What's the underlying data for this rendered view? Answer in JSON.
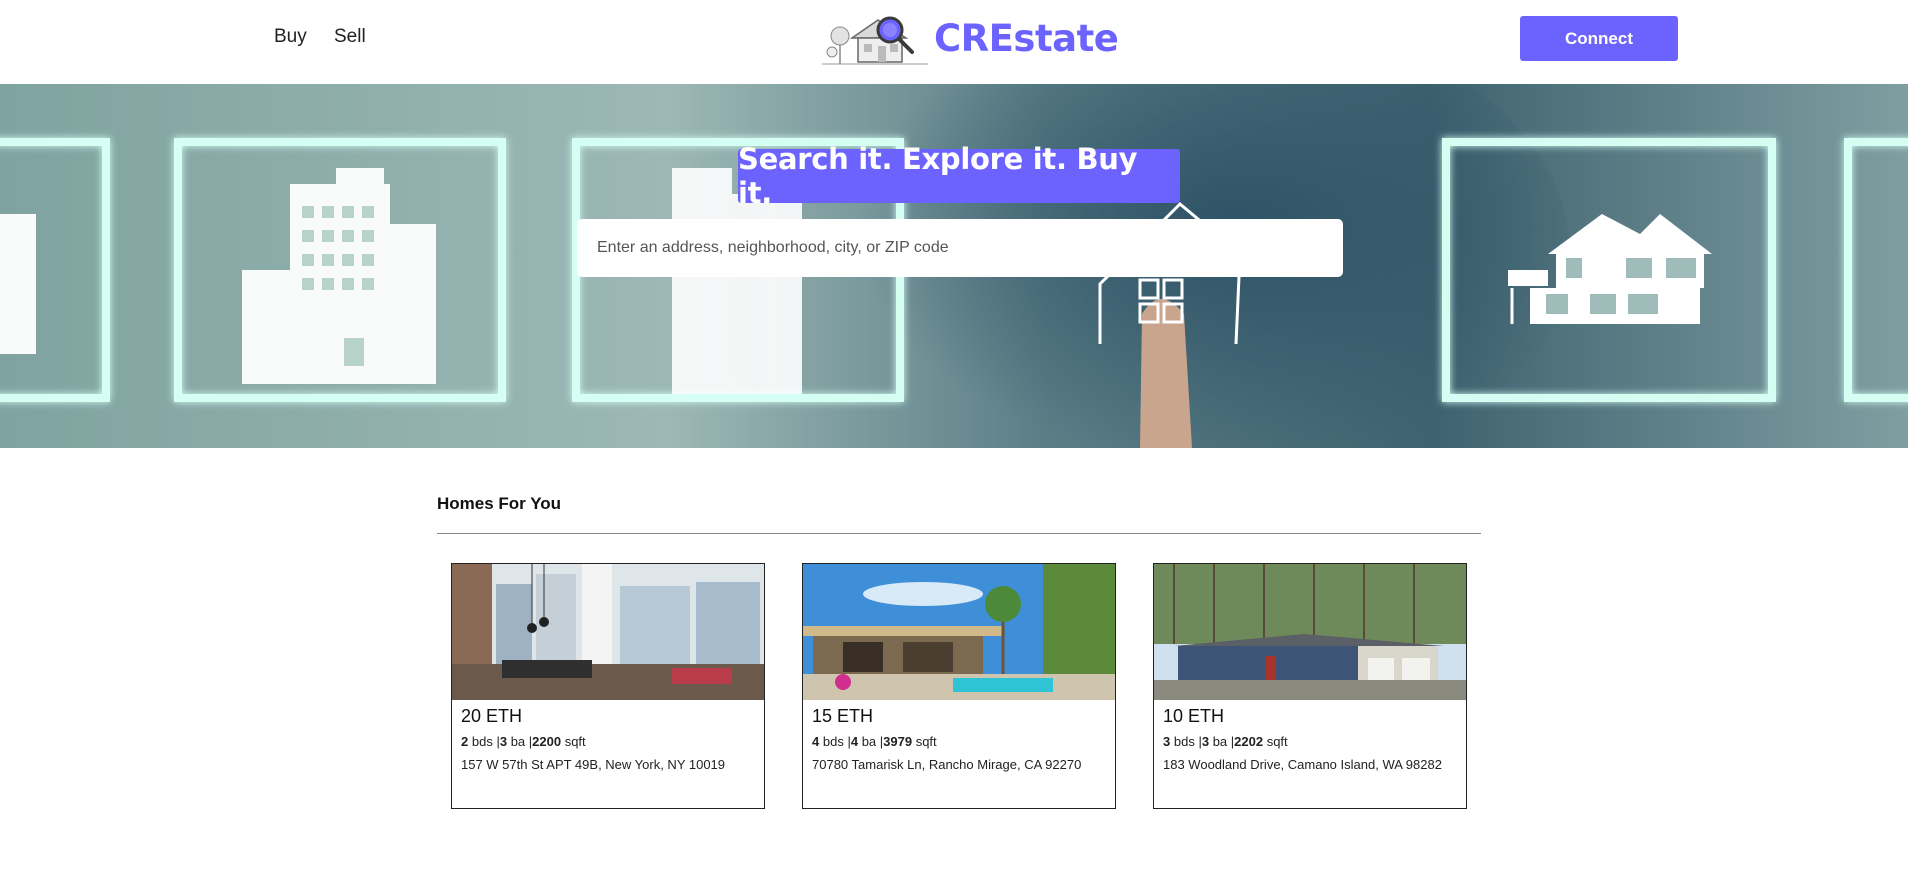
{
  "header": {
    "nav": {
      "buy": "Buy",
      "sell": "Sell"
    },
    "logo_text": "CREstate",
    "connect_label": "Connect"
  },
  "hero": {
    "title": "Search it. Explore it. Buy it.",
    "search_placeholder": "Enter an address, neighborhood, city, or ZIP code"
  },
  "homes": {
    "section_title": "Homes For You",
    "items": [
      {
        "price": "20 ETH",
        "beds": "2",
        "beds_unit": "bds",
        "baths": "3",
        "baths_unit": "ba",
        "sqft": "2200",
        "sqft_unit": "sqft",
        "address": "157 W 57th St APT 49B, New York, NY 10019"
      },
      {
        "price": "15 ETH",
        "beds": "4",
        "beds_unit": "bds",
        "baths": "4",
        "baths_unit": "ba",
        "sqft": "3979",
        "sqft_unit": "sqft",
        "address": "70780 Tamarisk Ln, Rancho Mirage, CA 92270"
      },
      {
        "price": "10 ETH",
        "beds": "3",
        "beds_unit": "bds",
        "baths": "3",
        "baths_unit": "ba",
        "sqft": "2202",
        "sqft_unit": "sqft",
        "address": "183 Woodland Drive, Camano Island, WA 98282"
      }
    ]
  },
  "colors": {
    "accent": "#6c63ff",
    "hero_frame_glow": "#d6fff3",
    "hero_bg": "#7fa3a2"
  }
}
